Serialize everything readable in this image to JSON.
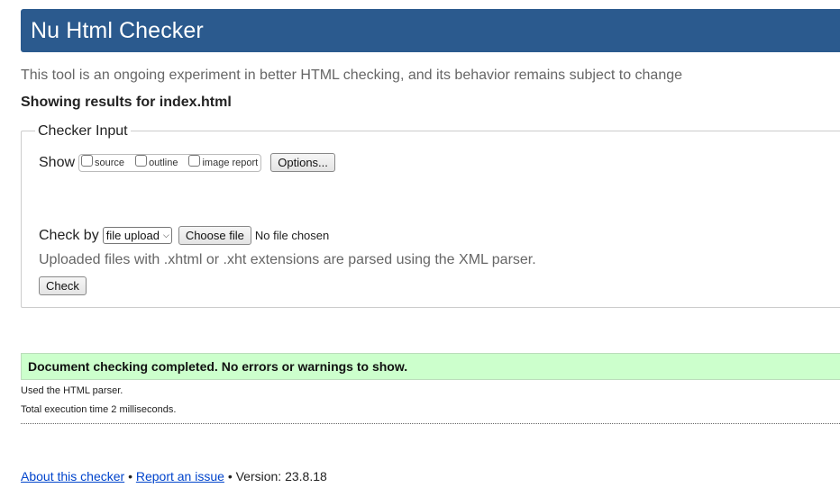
{
  "header": {
    "title": "Nu Html Checker"
  },
  "tagline": "This tool is an ongoing experiment in better HTML checking, and its behavior remains subject to change",
  "results_for": "Showing results for index.html",
  "checker_input": {
    "legend": "Checker Input",
    "show_label": "Show",
    "show_options": [
      {
        "label": "source",
        "checked": false
      },
      {
        "label": "outline",
        "checked": false
      },
      {
        "label": "image report",
        "checked": false
      }
    ],
    "options_button": "Options...",
    "check_by_label": "Check by",
    "check_by_selected": "file upload",
    "choose_file_button": "Choose file",
    "file_status": "No file chosen",
    "note": "Uploaded files with .xhtml or .xht extensions are parsed using the XML parser.",
    "check_button": "Check"
  },
  "result": {
    "success_message": "Document checking completed. No errors or warnings to show.",
    "parser_info": "Used the HTML parser.",
    "execution_time": "Total execution time 2 milliseconds."
  },
  "footer": {
    "about_link": "About this checker",
    "separator": "•",
    "report_link": "Report an issue",
    "version": "Version: 23.8.18"
  },
  "colors": {
    "header_bg": "#2b5a8e",
    "success_bg": "#ccffcc",
    "link": "#0044cc"
  }
}
